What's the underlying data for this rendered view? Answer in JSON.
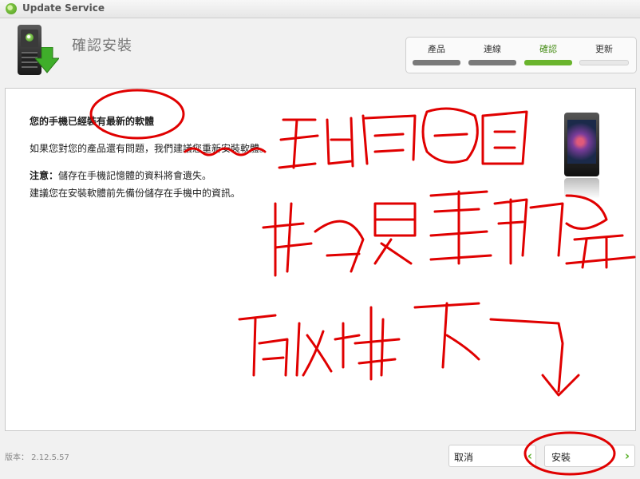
{
  "window": {
    "title": "Update Service"
  },
  "header": {
    "title": "確認安裝",
    "steps": [
      {
        "label": "產品",
        "state": "done"
      },
      {
        "label": "連線",
        "state": "done"
      },
      {
        "label": "確認",
        "state": "active"
      },
      {
        "label": "更新",
        "state": "future"
      }
    ]
  },
  "content": {
    "headline": "您的手機已經裝有最新的軟體",
    "line1": "如果您對您的產品還有問題，我們建議您重新安裝軟體。",
    "note_label": "注意：",
    "note_text": "儲存在手機記憶體的資料將會遺失。",
    "line3": "建議您在安裝軟體前先備份儲存在手機中的資訊。"
  },
  "footer": {
    "version": "版本： 2.12.5.57",
    "cancel_label": "取消",
    "install_label": "安裝"
  },
  "colors": {
    "accent_green": "#6ab42d",
    "annotation_red": "#e00000"
  },
  "icons": [
    "phone-download-icon",
    "device-image",
    "chevron-left-icon",
    "chevron-right-icon"
  ]
}
